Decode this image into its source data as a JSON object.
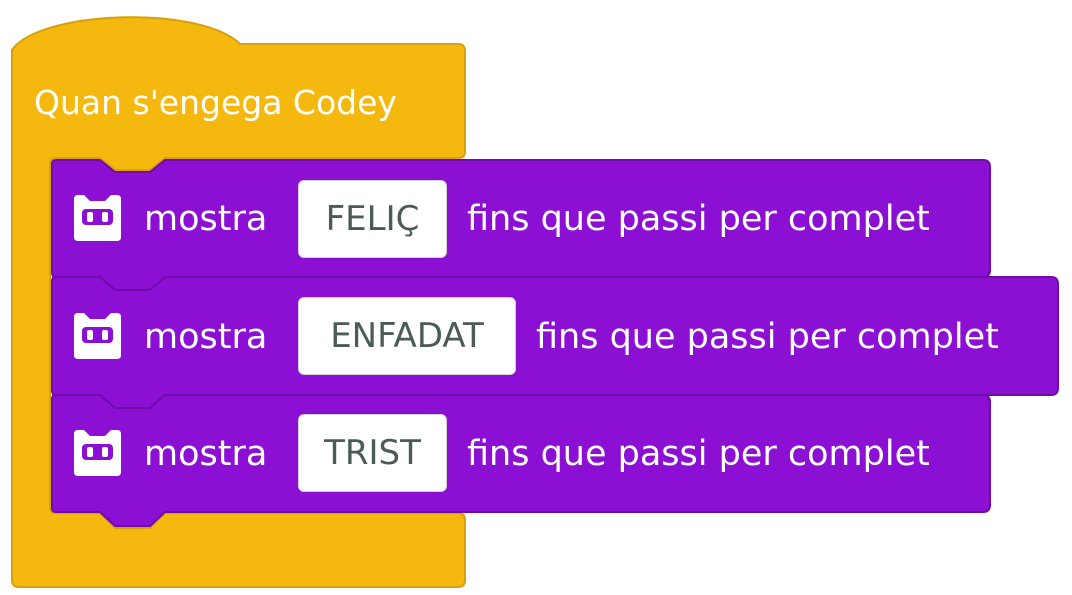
{
  "colors": {
    "event_block": "#F4B80E",
    "event_block_border": "#D8A00C",
    "looks_block": "#8C0FD4",
    "looks_block_border": "#6F0BA8",
    "field_text": "#4A5B58"
  },
  "hat_block": {
    "label": "Quan s'engega Codey"
  },
  "blocks": [
    {
      "icon": "codey-face-icon",
      "verb": "mostra",
      "emotion": "FELIÇ",
      "suffix": "fins que passi per complet"
    },
    {
      "icon": "codey-face-icon",
      "verb": "mostra",
      "emotion": "ENFADAT",
      "suffix": "fins que passi per complet"
    },
    {
      "icon": "codey-face-icon",
      "verb": "mostra",
      "emotion": "TRIST",
      "suffix": "fins que passi per complet"
    }
  ]
}
